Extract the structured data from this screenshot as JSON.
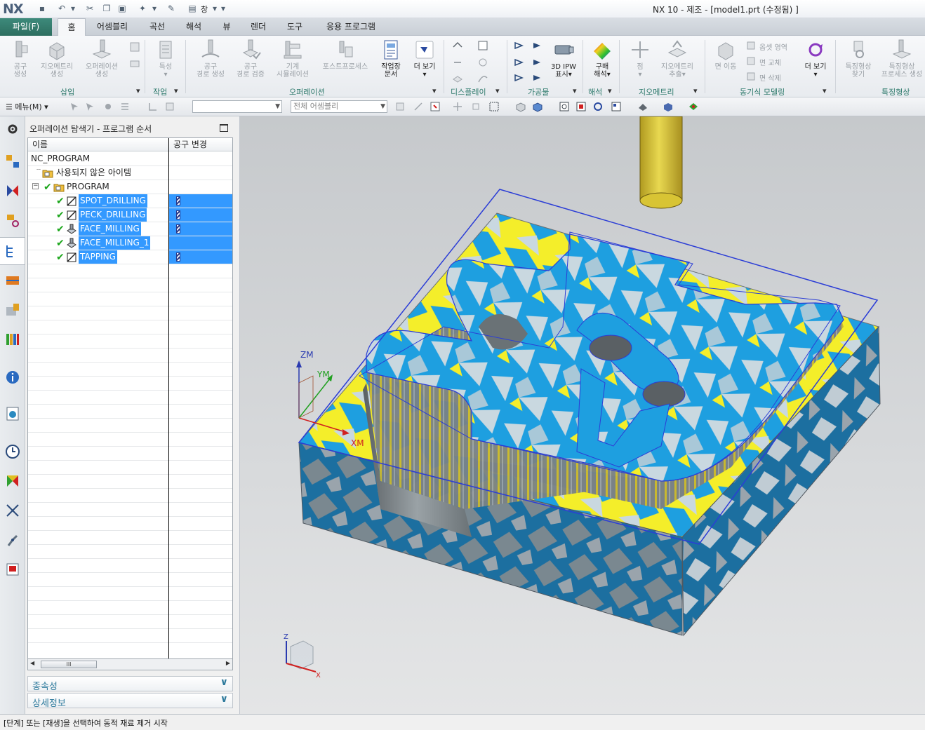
{
  "app": {
    "logo": "NX",
    "title": "NX 10 - 제조 - [model1.prt (수정됨) ]",
    "window_label": "창"
  },
  "tabs": {
    "file": "파일(F)",
    "items": [
      "홈",
      "어셈블리",
      "곡선",
      "해석",
      "뷰",
      "렌더",
      "도구",
      "응용 프로그램"
    ]
  },
  "ribbon": {
    "insert": {
      "create_tool": "공구\n생성",
      "create_geometry": "지오메트리\n생성",
      "create_operation": "오퍼레이션\n생성",
      "group": "삽입"
    },
    "work": {
      "properties": "특성",
      "group": "작업"
    },
    "operation": {
      "gen_toolpath": "공구\n경로 생성",
      "verify_toolpath": "공구\n경로 검증",
      "machine_sim": "기계\n시뮬레이션",
      "postprocess": "포스트프로세스",
      "shop_docs": "작업장\n문서",
      "more": "더 보기",
      "group": "오퍼레이션"
    },
    "display": {
      "group": "디스플레이"
    },
    "workpiece": {
      "ipw": "3D IPW\n표시",
      "group": "가공물"
    },
    "analysis": {
      "gradient": "구배\n해석",
      "group": "해석"
    },
    "geometry": {
      "point": "점",
      "extract_geometry": "지오메트리\n추출",
      "group": "지오메트리"
    },
    "sync": {
      "move_face": "면 이동",
      "offset_region": "옵셋 영역",
      "replace_face": "면 교체",
      "delete_face": "면 삭제",
      "more": "더 보기",
      "group": "동기식 모델링"
    },
    "feature": {
      "find_feature": "특징형상\n찾기",
      "feature_process": "특징형상\n프로세스 생성",
      "group": "특징형상"
    }
  },
  "toolbar2": {
    "menu": "메뉴(M)",
    "filter_value": "",
    "assembly_scope": "전체 어셈블리"
  },
  "navigator": {
    "title": "오퍼레이션 탐색기 - 프로그램 순서",
    "columns": [
      "이름",
      "공구 변경"
    ],
    "root": "NC_PROGRAM",
    "unused": "사용되지 않은 아이템",
    "program": "PROGRAM",
    "operations": [
      {
        "name": "SPOT_DRILLING",
        "tool_change": true
      },
      {
        "name": "PECK_DRILLING",
        "tool_change": true
      },
      {
        "name": "FACE_MILLING",
        "tool_change": true
      },
      {
        "name": "FACE_MILLING_1",
        "tool_change": false
      },
      {
        "name": "TAPPING",
        "tool_change": true
      }
    ],
    "scroll_thumb": "III",
    "dependencies": "종속성",
    "details": "상세정보"
  },
  "viewport": {
    "axis_zm": "ZM",
    "axis_ym": "YM",
    "axis_xm": "XM",
    "triad_z": "Z",
    "triad_x": "X",
    "colors": {
      "stock_blue": "#1e9fe0",
      "stock_yellow": "#f4ee2a",
      "part_gray": "#c9d8e0",
      "wall_gray": "#8c9296",
      "side_blue": "#1c6fa0",
      "tool_yellow": "#d8c434",
      "boundary": "#2b3dd6"
    }
  },
  "status": {
    "text": "[단계] 또는 [재생]을 선택하여 동적 재료 제거 시작"
  }
}
